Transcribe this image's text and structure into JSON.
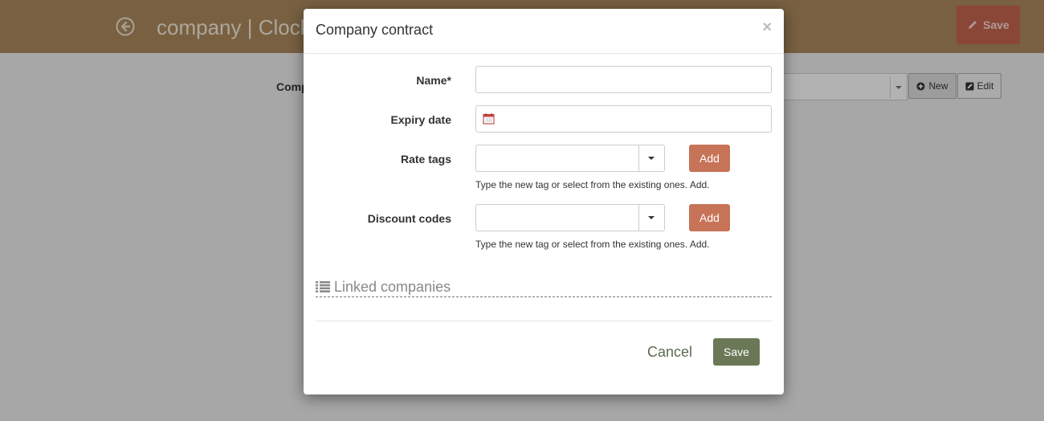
{
  "background": {
    "page_title": "company | Clock",
    "save_label": "Save",
    "field_label": "Comp",
    "new_label": "New",
    "edit_label": "Edit"
  },
  "modal": {
    "title": "Company contract",
    "close_symbol": "×",
    "fields": {
      "name": {
        "label": "Name*",
        "value": ""
      },
      "expiry": {
        "label": "Expiry date",
        "value": ""
      },
      "rate_tags": {
        "label": "Rate tags",
        "value": "",
        "add_label": "Add",
        "help": "Type the new tag or select from the existing ones. Add."
      },
      "discount_codes": {
        "label": "Discount codes",
        "value": "",
        "add_label": "Add",
        "help": "Type the new tag or select from the existing ones. Add."
      }
    },
    "section_title": "Linked companies",
    "cancel_label": "Cancel",
    "save_label": "Save"
  },
  "colors": {
    "topbar": "#a7865a",
    "add_button": "#c67358",
    "save_button": "#6a7858"
  },
  "icons": [
    "back-arrow-circle-icon",
    "pencil-icon",
    "plus-circle-icon",
    "edit-icon",
    "close-icon",
    "calendar-icon",
    "chevron-down-icon",
    "list-icon"
  ]
}
